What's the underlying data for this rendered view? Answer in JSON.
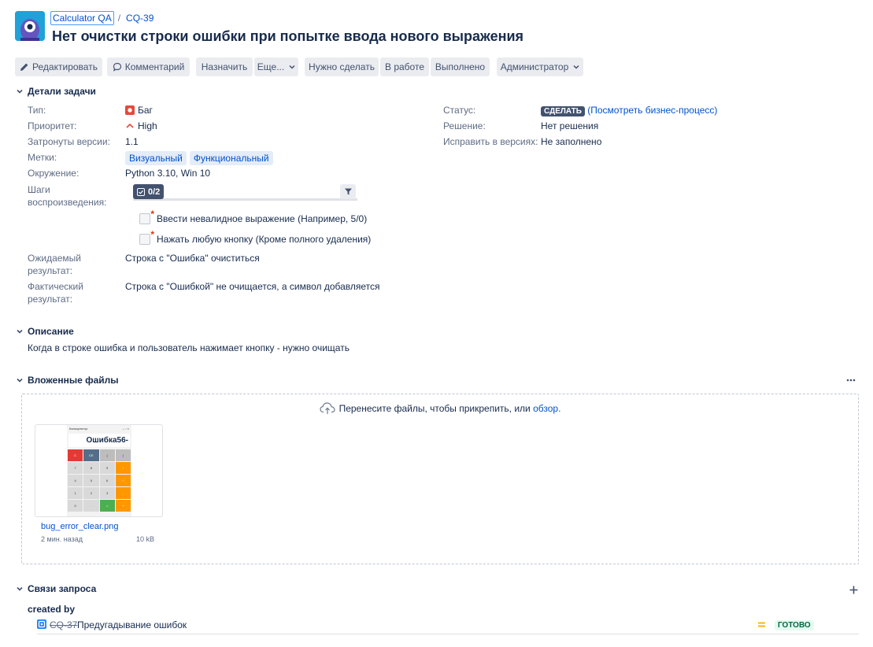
{
  "breadcrumb": {
    "project": "Calculator QA",
    "separator": "/",
    "issue_key": "CQ-39"
  },
  "issue": {
    "title": "Нет очистки строки ошибки при попытке ввода нового выражения"
  },
  "toolbar": {
    "edit": "Редактировать",
    "comment": "Комментарий",
    "assign": "Назначить",
    "more": "Еще...",
    "todo": "Нужно сделать",
    "in_progress": "В работе",
    "done": "Выполнено",
    "admin": "Администратор"
  },
  "details": {
    "heading": "Детали задачи",
    "type_label": "Тип:",
    "type_value": "Баг",
    "priority_label": "Приоритет:",
    "priority_value": "High",
    "affects_label": "Затронуты версии:",
    "affects_value": "1.1",
    "labels_label": "Метки:",
    "labels": [
      "Визуальный",
      "Функциональный"
    ],
    "environment_label": "Окружение:",
    "environment_value": "Python 3.10, Win 10",
    "steps_label_1": "Шаги",
    "steps_label_2": "воспроизведения:",
    "checklist_progress": "0/2",
    "checklist_items": [
      "Ввести невалидное выражение (Например, 5/0)",
      "Нажать любую кнопку (Кроме полного удаления)"
    ],
    "expected_label_1": "Ожидаемый",
    "expected_label_2": "результат:",
    "expected_value": "Строка с \"Ошибка\" очиститься",
    "actual_label_1": "Фактический",
    "actual_label_2": "результат:",
    "actual_value": "Строка с \"Ошибкой\" не очищается, а символ добавляется",
    "status_label": "Статус:",
    "status_value": "СДЕЛАТЬ",
    "status_workflow_link": "(Посмотреть бизнес-процесс)",
    "resolution_label": "Решение:",
    "resolution_value": "Нет решения",
    "fix_label": "Исправить в версиях:",
    "fix_value": "Не заполнено"
  },
  "description": {
    "heading": "Описание",
    "text": "Когда в строке ошибка и пользователь нажимает кнопку - нужно очищать"
  },
  "attachments": {
    "heading": "Вложенные файлы",
    "more_icon": "ellipsis-icon",
    "drop_text": "Перенесите файлы, чтобы прикрепить, или",
    "browse_link": "обзор.",
    "file": {
      "name": "bug_error_clear.png",
      "age": "2 мин. назад",
      "size": "10 kB",
      "preview_title": "Калькулятор",
      "preview_display": "Ошибка56-",
      "preview_keys": [
        "C",
        "CE",
        "(",
        ")",
        "7",
        "8",
        "9",
        "/",
        "4",
        "5",
        "6",
        "*",
        "1",
        "2",
        "3",
        "-",
        "0",
        ".",
        "=",
        "+"
      ]
    }
  },
  "links": {
    "heading": "Связи запроса",
    "add_icon": "plus-icon",
    "relation": "created by",
    "linked_key": "CQ-37",
    "linked_summary": "Предугадывание ошибок",
    "linked_status": "ГОТОВО"
  },
  "colors": {
    "link": "#0052cc",
    "bug": "#e5493a",
    "priority_high": "#e5493a",
    "status_dark": "#42526e",
    "done_green": "#006644",
    "calc_red": "#e53935",
    "calc_orange": "#ff9800",
    "calc_green": "#4caf50",
    "calc_blue": "#546e8a"
  }
}
